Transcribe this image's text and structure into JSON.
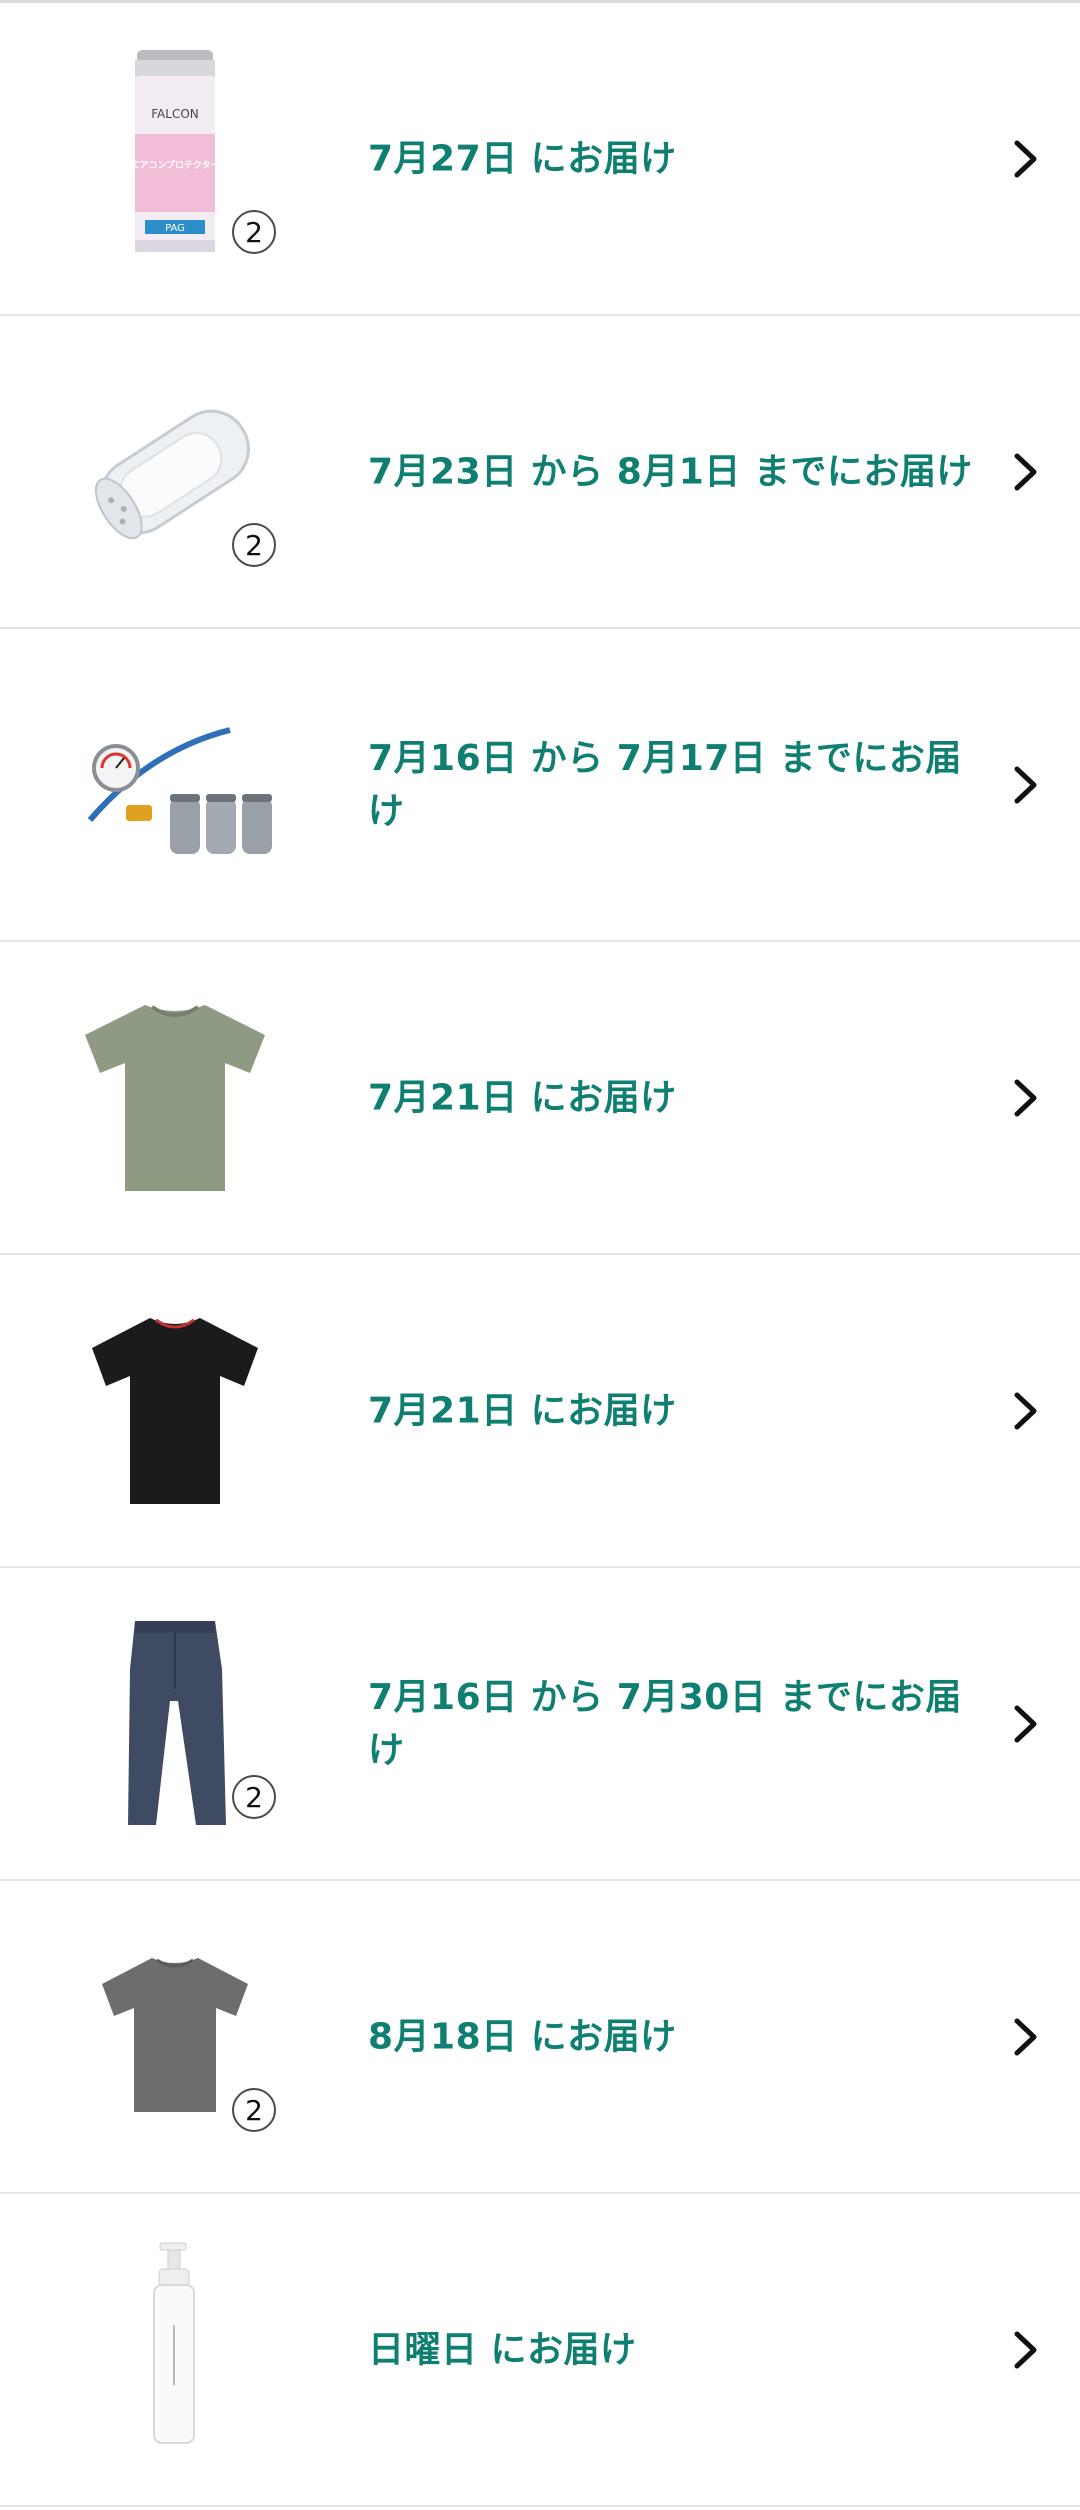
{
  "colors": {
    "accent": "#0f7f72",
    "divider": "#e3e6e6",
    "chevron": "#111111"
  },
  "shipments": [
    {
      "product_image": "aircon-protector-can-image",
      "quantity": "2",
      "delivery_text": "7月27日 にお届け",
      "can_label_brand": "FALCON",
      "can_label_title": "エアコンプロテクター",
      "can_label_sub": "PAG"
    },
    {
      "product_image": "clear-cylinder-filter-image",
      "quantity": "2",
      "delivery_text": "7月23日 から 8月1日 までにお届け"
    },
    {
      "product_image": "gauge-manifold-refrigerant-cans-image",
      "quantity": "",
      "delivery_text": "7月16日 から 7月17日 までにお届け"
    },
    {
      "product_image": "olive-tshirt-image",
      "quantity": "",
      "delivery_text": "7月21日 にお届け"
    },
    {
      "product_image": "black-tshirt-image",
      "quantity": "",
      "delivery_text": "7月21日 にお届け"
    },
    {
      "product_image": "navy-jeans-image",
      "quantity": "2",
      "delivery_text": "7月16日 から 7月30日 までにお届け"
    },
    {
      "product_image": "gray-tshirt-image",
      "quantity": "2",
      "delivery_text": "8月18日 にお届け"
    },
    {
      "product_image": "white-pump-bottle-image",
      "quantity": "",
      "delivery_text": "日曜日 にお届け"
    }
  ]
}
